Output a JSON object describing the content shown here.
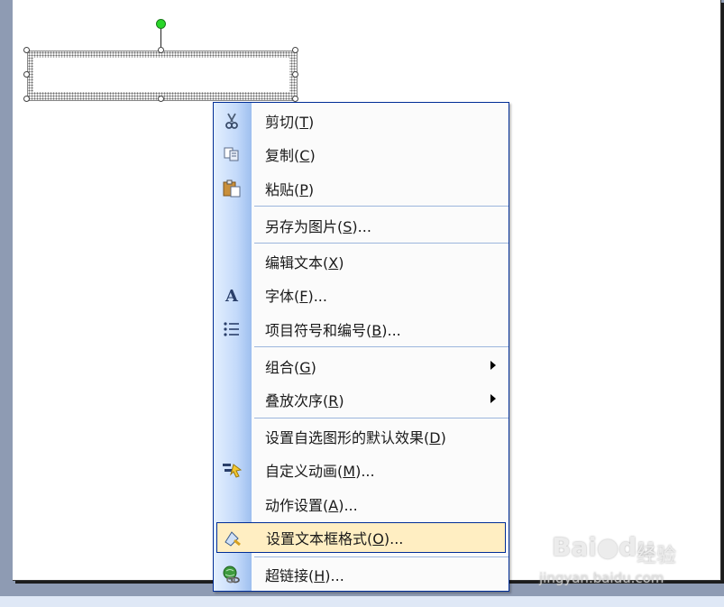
{
  "menu": {
    "items": [
      {
        "text": "剪切",
        "key": "T",
        "suffix": "",
        "icon": "scissors-icon"
      },
      {
        "text": "复制",
        "key": "C",
        "suffix": "",
        "icon": "copy-icon"
      },
      {
        "text": "粘贴",
        "key": "P",
        "suffix": "",
        "icon": "paste-icon"
      },
      {
        "text": "另存为图片",
        "key": "S",
        "suffix": "...",
        "icon": ""
      },
      {
        "text": "编辑文本",
        "key": "X",
        "suffix": "",
        "icon": ""
      },
      {
        "text": "字体",
        "key": "F",
        "suffix": "...",
        "icon": "font-icon"
      },
      {
        "text": "项目符号和编号",
        "key": "B",
        "suffix": "...",
        "icon": "bullets-icon"
      },
      {
        "text": "组合",
        "key": "G",
        "suffix": "",
        "icon": "",
        "submenu": true
      },
      {
        "text": "叠放次序",
        "key": "R",
        "suffix": "",
        "icon": "",
        "submenu": true
      },
      {
        "text": "设置自选图形的默认效果",
        "key": "D",
        "suffix": "",
        "icon": ""
      },
      {
        "text": "自定义动画",
        "key": "M",
        "suffix": "...",
        "icon": "custom-animation-icon"
      },
      {
        "text": "动作设置",
        "key": "A",
        "suffix": "...",
        "icon": ""
      },
      {
        "text": "设置文本框格式",
        "key": "O",
        "suffix": "...",
        "icon": "format-textbox-icon",
        "highlighted": true
      },
      {
        "text": "超链接",
        "key": "H",
        "suffix": "...",
        "icon": "hyperlink-icon"
      }
    ]
  },
  "watermark": {
    "logo": "Bai",
    "logo_tail": "du",
    "jingyan": "经验",
    "url": "jingyan.baidu.com"
  },
  "colors": {
    "menu_border": "#002d96",
    "highlight": "#ffeec2",
    "desktop": "#8e9bb3"
  }
}
